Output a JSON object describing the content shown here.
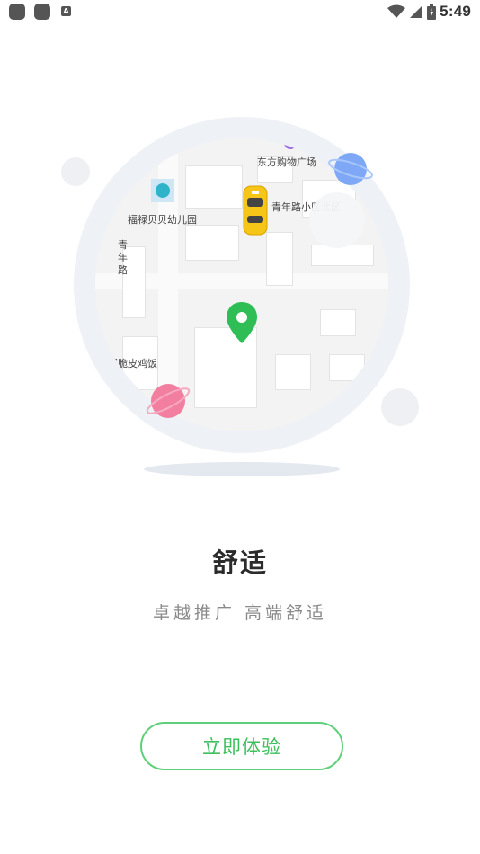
{
  "status_bar": {
    "time": "5:49",
    "left_icons": [
      "app-icon",
      "app-icon",
      "accessibility-a-icon"
    ],
    "right_icons": [
      "wifi-icon",
      "cell-signal-icon",
      "battery-charging-icon"
    ]
  },
  "map": {
    "labels": {
      "mall": "东方购物广场",
      "kindergarten": "福禄贝贝幼儿园",
      "residential": "青年路小区北区",
      "road": "青年路",
      "restaurant": "锅脆皮鸡饭"
    }
  },
  "content": {
    "title": "舒适",
    "subtitle": "卓越推广 高端舒适",
    "cta_label": "立即体验"
  },
  "colors": {
    "accent_green": "#3cbf5c",
    "button_border": "#5fd07a",
    "taxi_yellow": "#f5c518",
    "planet_blue": "#7ea8f5",
    "planet_pink": "#f27ea0"
  }
}
